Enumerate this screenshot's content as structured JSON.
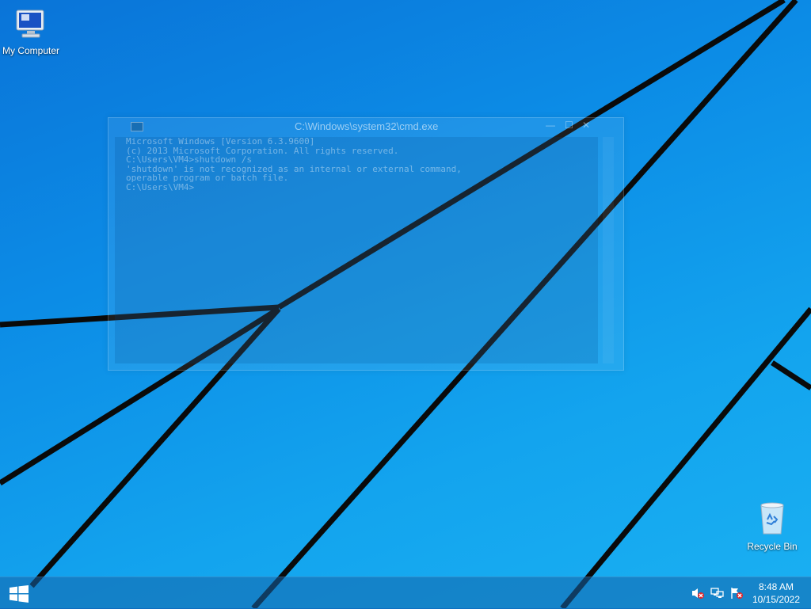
{
  "desktop": {
    "icons": [
      {
        "label": "My Computer",
        "icon": "computer-icon"
      },
      {
        "label": "Recycle Bin",
        "icon": "recycle-bin-icon"
      }
    ]
  },
  "console": {
    "title": "C:\\Windows\\system32\\cmd.exe",
    "lines": [
      "Microsoft Windows [Version 6.3.9600]",
      "(c) 2013 Microsoft Corporation. All rights reserved.",
      "",
      "C:\\Users\\VM4>shutdown /s",
      "'shutdown' is not recognized as an internal or external command,",
      "operable program or batch file.",
      "",
      "C:\\Users\\VM4>"
    ]
  },
  "taskbar": {
    "start_icon": "windows-logo-icon",
    "tray": [
      {
        "icon": "speaker-muted-icon"
      },
      {
        "icon": "network-icon"
      },
      {
        "icon": "action-center-flag-icon"
      }
    ],
    "time": "8:48 AM",
    "date": "10/15/2022"
  },
  "colors": {
    "wallpaper": "#0c8ce6",
    "wallpaper_lines": "#0a0a0a",
    "taskbar": "#1464aa"
  }
}
